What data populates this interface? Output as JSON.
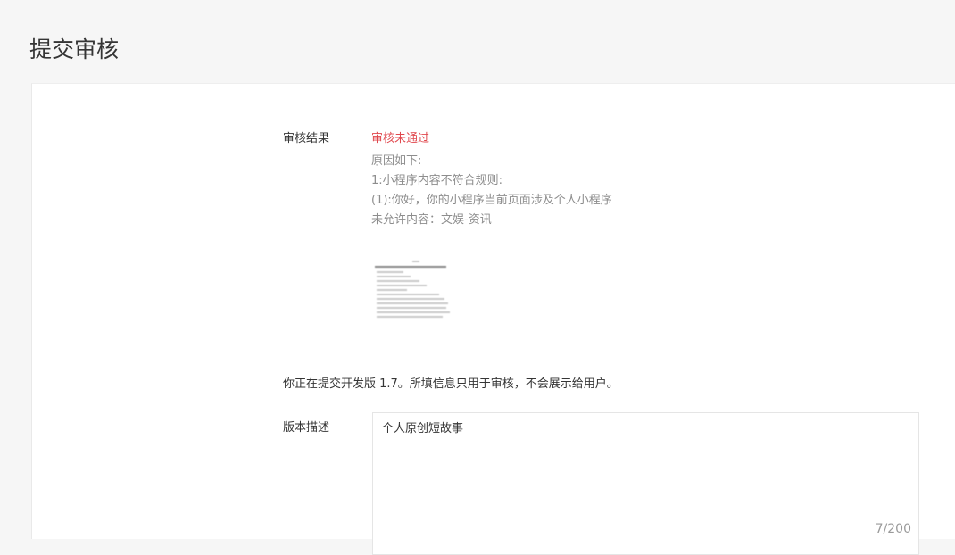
{
  "page": {
    "title": "提交审核"
  },
  "review": {
    "label": "审核结果",
    "status": "审核未通过",
    "reasons": [
      "原因如下:",
      "1:小程序内容不符合规则:",
      "(1):你好，你的小程序当前页面涉及个人小程序",
      "未允许内容：文娱-资讯"
    ]
  },
  "notice": {
    "text": "你正在提交开发版 1.7。所填信息只用于审核，不会展示给用户。"
  },
  "version_description": {
    "label": "版本描述",
    "value": "个人原创短故事",
    "counter": "7/200"
  },
  "colors": {
    "status_fail": "#e0484e",
    "reason_text": "#8d8d8d",
    "page_bg": "#f6f6f6"
  }
}
